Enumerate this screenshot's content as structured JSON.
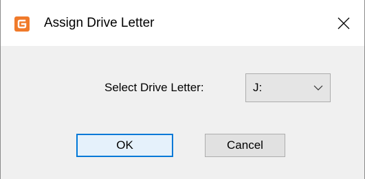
{
  "window": {
    "title": "Assign Drive Letter",
    "icon": "partition-app-icon",
    "close_icon": "close-icon"
  },
  "form": {
    "drive_letter_label": "Select Drive Letter:",
    "drive_letter_value": "J:",
    "dropdown_icon": "chevron-down-icon"
  },
  "buttons": {
    "ok_label": "OK",
    "cancel_label": "Cancel"
  },
  "colors": {
    "app_icon": "#f07a2a",
    "focus_border": "#0078d7"
  }
}
